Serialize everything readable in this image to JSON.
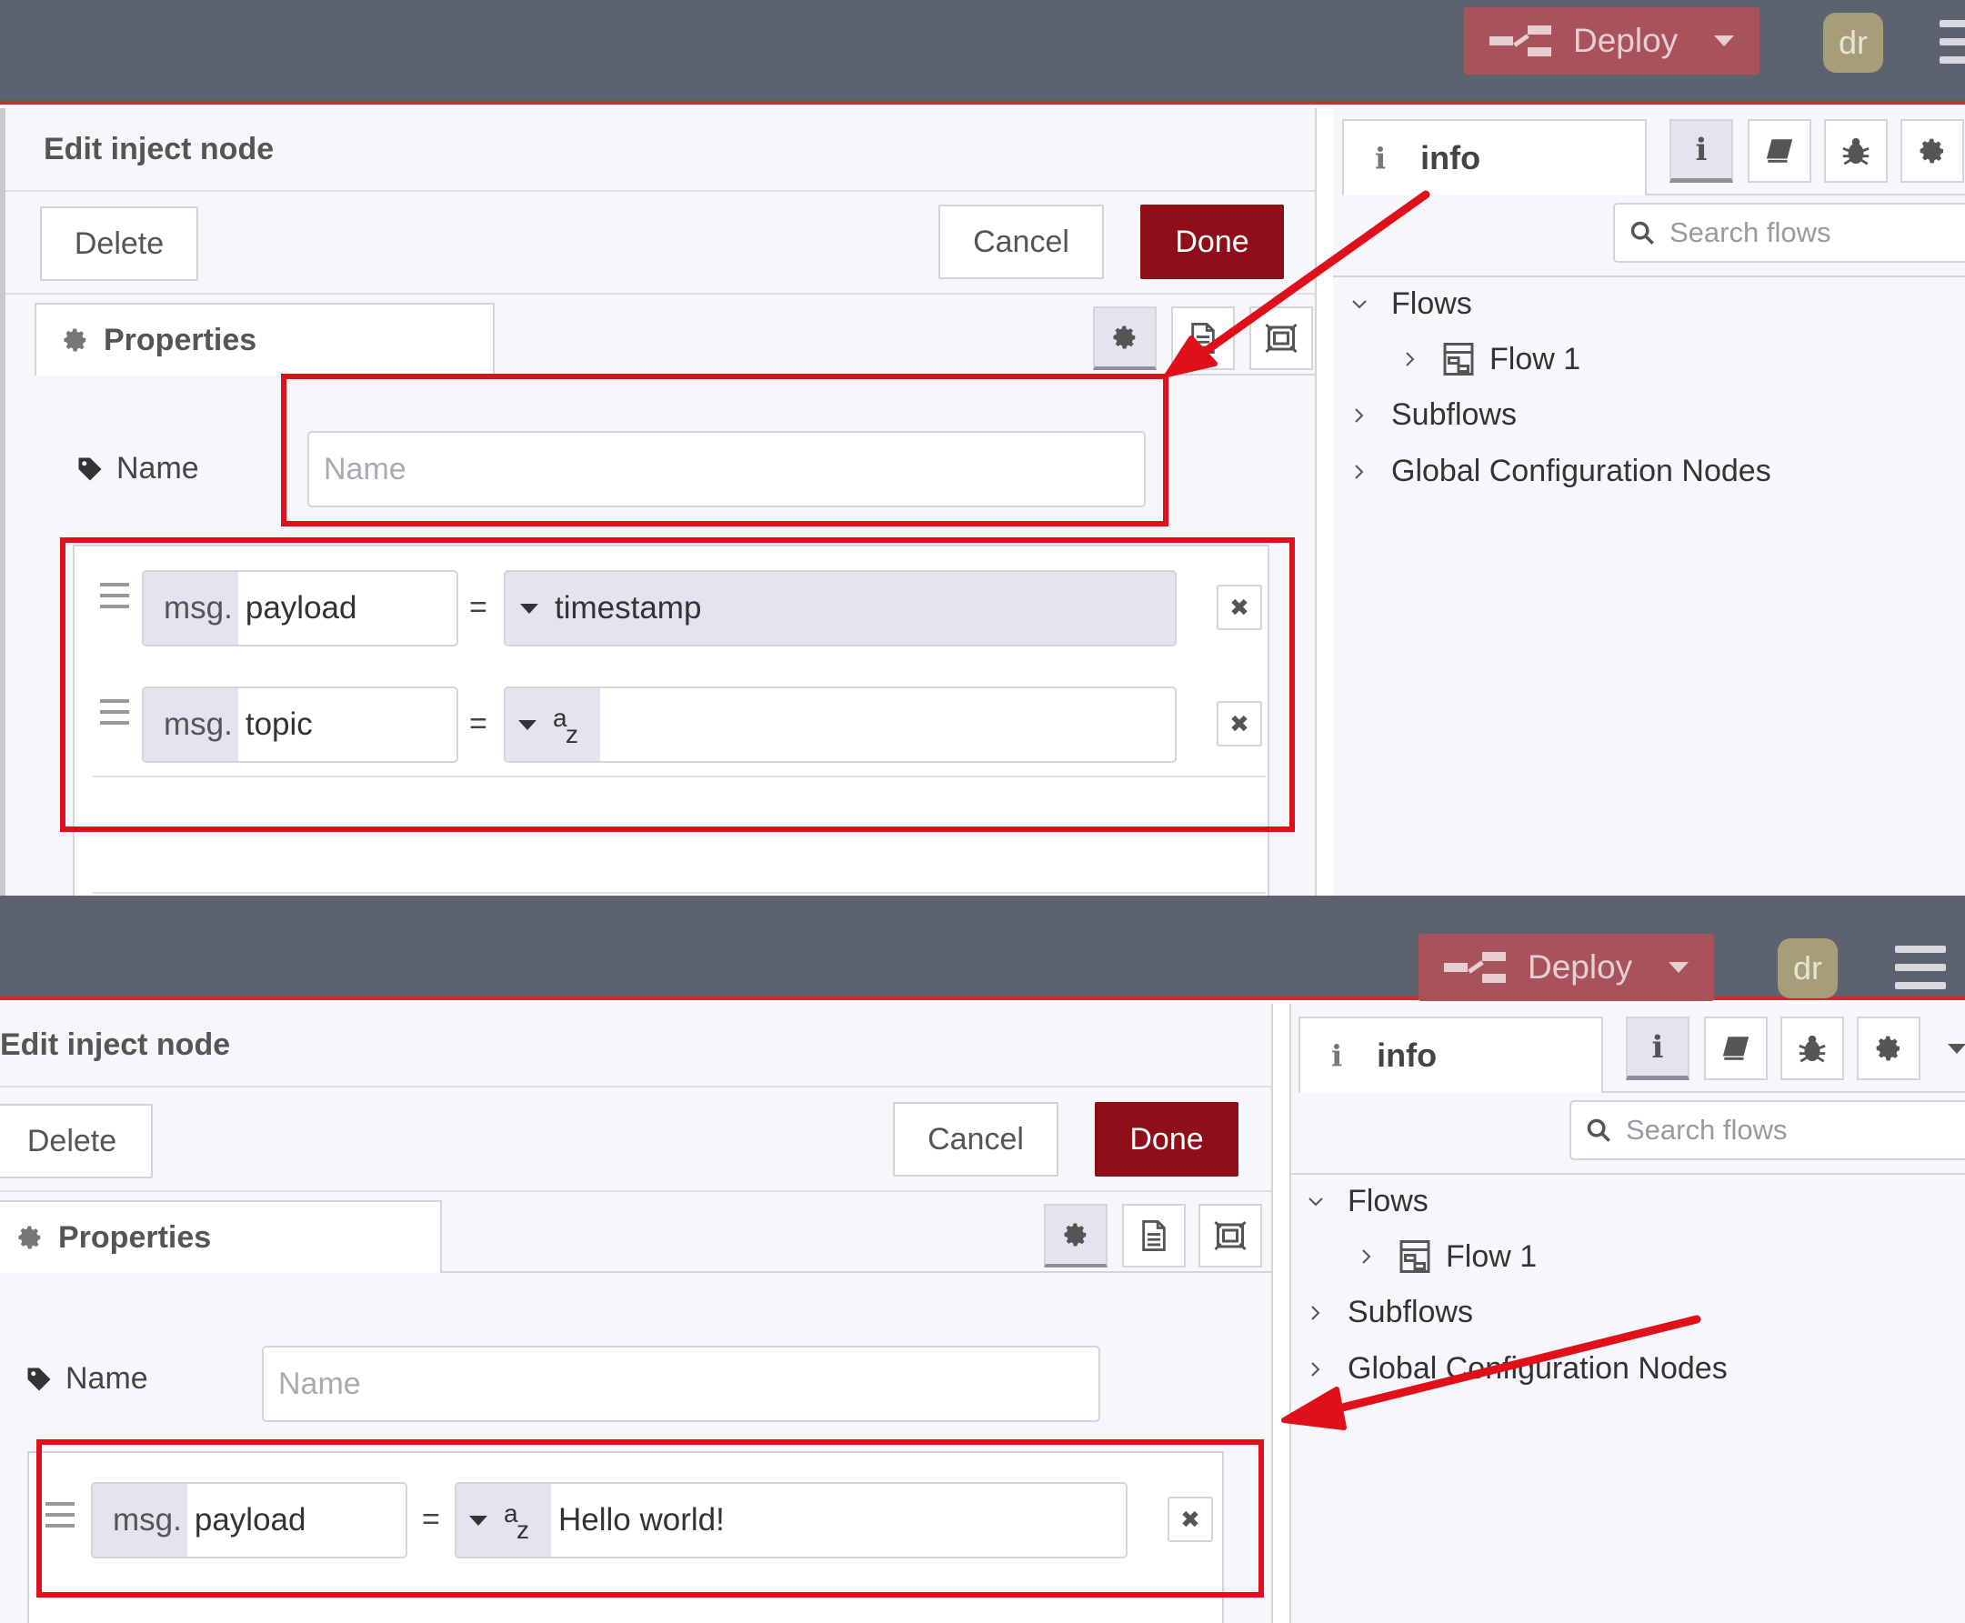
{
  "header": {
    "deploy_label": "Deploy",
    "avatar_initials": "dr"
  },
  "editor": {
    "title": "Edit inject node",
    "delete_label": "Delete",
    "cancel_label": "Cancel",
    "done_label": "Done",
    "properties_tab": "Properties",
    "name_label": "Name",
    "name_placeholder": "Name",
    "msg_prefix": "msg.",
    "equals": "="
  },
  "top": {
    "rows": [
      {
        "property": "payload",
        "type_label": "timestamp",
        "value": ""
      },
      {
        "property": "topic",
        "type_label": "az",
        "value": ""
      }
    ]
  },
  "bottom": {
    "rows": [
      {
        "property": "payload",
        "type_label": "az",
        "value": "Hello world!"
      }
    ]
  },
  "sidebar": {
    "tab_label": "info",
    "search_placeholder": "Search flows",
    "tree": {
      "flows": "Flows",
      "flow1": "Flow 1",
      "subflows": "Subflows",
      "global_config": "Global Configuration Nodes"
    }
  },
  "colors": {
    "header_bg": "#5d626f",
    "deploy_bg": "#a8535b",
    "done_bg": "#8e0e19",
    "annotation": "#e0101b"
  },
  "icons": [
    "deploy-icon",
    "caret-down-icon",
    "hamburger-menu-icon",
    "gear-icon",
    "description-icon",
    "appearance-icon",
    "tag-icon",
    "drag-handle-icon",
    "close-icon",
    "info-icon",
    "book-icon",
    "bug-icon",
    "search-icon",
    "chevron-down-icon",
    "chevron-right-icon",
    "flow-icon"
  ]
}
